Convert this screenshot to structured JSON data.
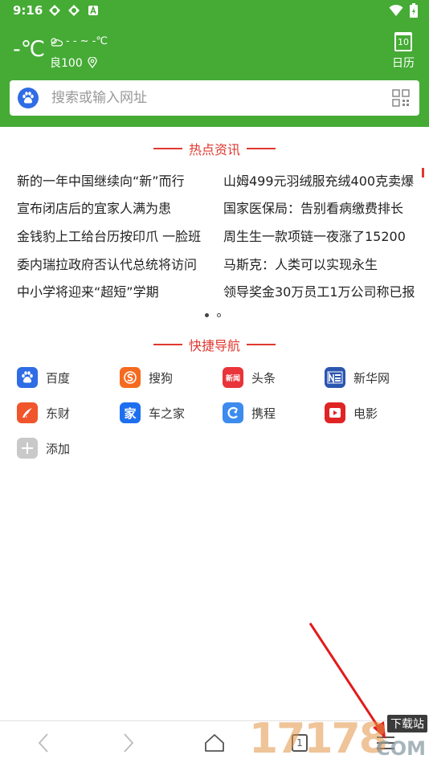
{
  "statusbar": {
    "time": "9:16"
  },
  "weather": {
    "temp": "-℃",
    "range": "- - ~ -℃",
    "aqi": "良100"
  },
  "calendar": {
    "day": "10",
    "label": "日历"
  },
  "search": {
    "placeholder": "搜索或输入网址"
  },
  "hot_news": {
    "title": "热点资讯",
    "left": [
      "新的一年中国继续向“新”而行",
      "宣布闭店后的宜家人满为患",
      "金钱豹上工给台历按印爪 一脸班",
      "委内瑞拉政府否认代总统将访问",
      "中小学将迎来“超短”学期"
    ],
    "right": [
      "山姆499元羽绒服充绒400克卖爆",
      "国家医保局：告别看病缴费排长",
      "周生生一款项链一夜涨了15200",
      "马斯克：人类可以实现永生",
      "领导奖金30万员工1万公司称已报"
    ]
  },
  "quick_nav": {
    "title": "快捷导航",
    "items": [
      {
        "label": "百度",
        "icon": "baidu-icon",
        "color": "#2f6ce5"
      },
      {
        "label": "搜狗",
        "icon": "sogou-icon",
        "color": "#f56a1f"
      },
      {
        "label": "头条",
        "icon": "toutiao-icon",
        "color": "#e8343a",
        "glyph": "新闻"
      },
      {
        "label": "新华网",
        "icon": "xinhua-icon",
        "color": "#2b56b0"
      },
      {
        "label": "东财",
        "icon": "dongcai-icon",
        "color": "#f0552c"
      },
      {
        "label": "车之家",
        "icon": "autohome-icon",
        "color": "#1d6ff0",
        "glyph": "家"
      },
      {
        "label": "携程",
        "icon": "ctrip-icon",
        "color": "#3d8bee"
      },
      {
        "label": "电影",
        "icon": "movie-icon",
        "color": "#e02424"
      },
      {
        "label": "添加",
        "icon": "add-icon",
        "color": "#c9c9c9"
      }
    ]
  },
  "bottombar": {
    "tab_count": "1"
  },
  "watermark": {
    "numbers": "17178",
    "tag": "下载站",
    "suffix": "COM"
  }
}
